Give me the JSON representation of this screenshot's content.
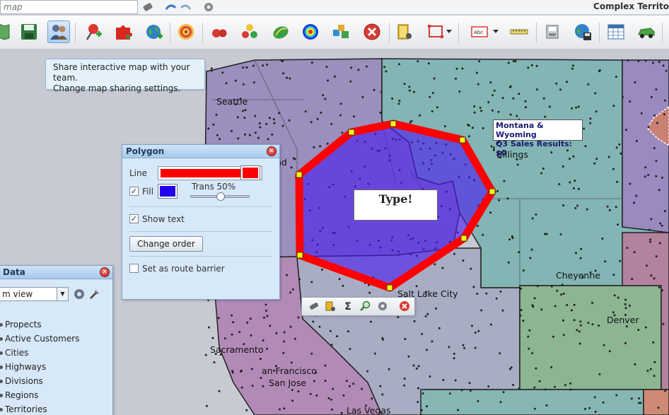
{
  "topbar": {
    "search_placeholder": "map",
    "app_title": "Complex Territo"
  },
  "tooltip": {
    "line1": "Share interactive map with your team.",
    "line2": "Change map sharing settings."
  },
  "map": {
    "cities": [
      "Seattle",
      "nd",
      "Billings",
      "Cheyenne",
      "Denver",
      "Salt Lake City",
      "Sacramento",
      "an Francisco",
      "San Jose",
      "Las Vegas"
    ],
    "sales_box": {
      "line1": "Montana & Wyoming",
      "line2": "Q3 Sales Results:  $0"
    },
    "shape_text": "Type!"
  },
  "polygon_panel": {
    "title": "Polygon",
    "line_label": "Line",
    "line_color": "#ff0000",
    "fill_label": "Fill",
    "fill_checked": true,
    "fill_color": "#2200ee",
    "transparency_label": "Trans 50%",
    "transparency": 0.5,
    "show_text_label": "Show text",
    "show_text_checked": true,
    "change_order_label": "Change order",
    "route_barrier_label": "Set as route barrier",
    "route_barrier_checked": false
  },
  "data_panel": {
    "title": "Data",
    "view_select": "m view",
    "items": [
      "Propects",
      "Active Customers",
      "Cities",
      "Highways",
      "Divisions",
      "Regions",
      "Territories"
    ]
  },
  "float_toolbar": {
    "sum_glyph": "Σ"
  }
}
